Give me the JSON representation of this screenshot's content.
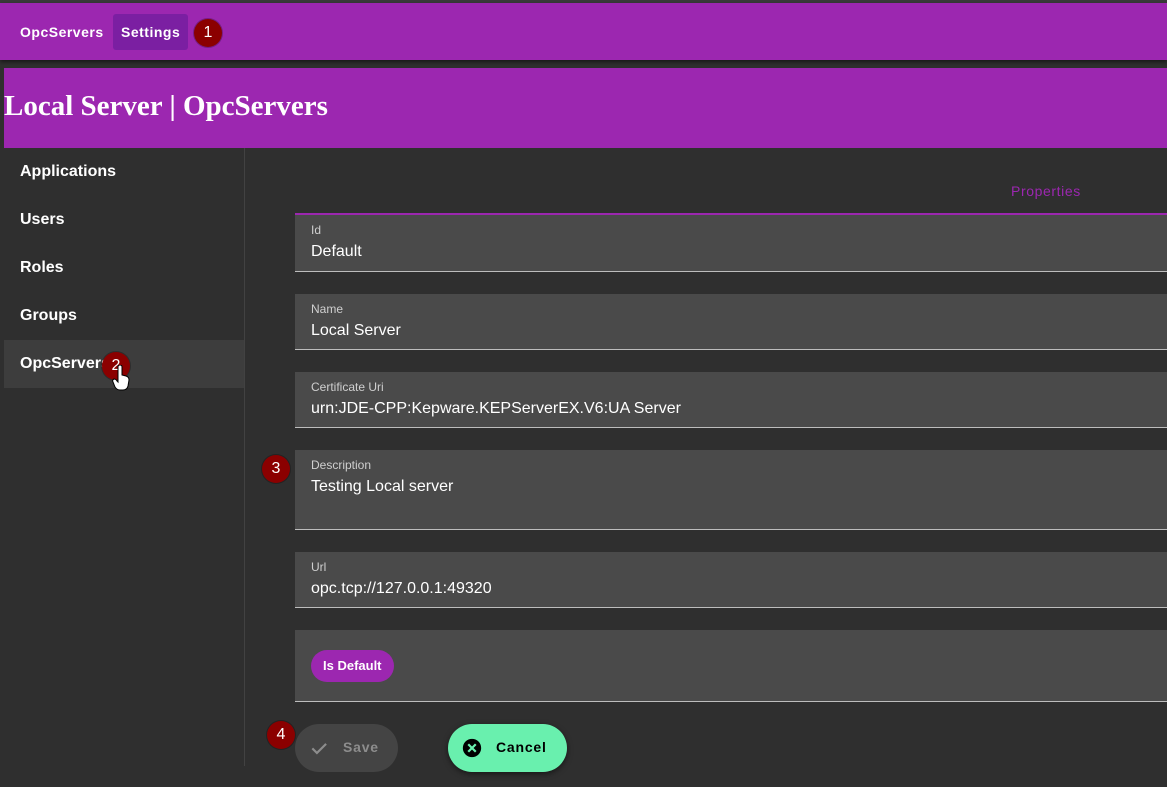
{
  "topbar": {
    "items": [
      {
        "label": "OpcServers"
      },
      {
        "label": "Settings",
        "active": true
      }
    ]
  },
  "markers": [
    "1",
    "2",
    "3",
    "4"
  ],
  "header": {
    "title": "Local Server | OpcServers"
  },
  "sidebar": {
    "items": [
      {
        "label": "Applications"
      },
      {
        "label": "Users"
      },
      {
        "label": "Roles"
      },
      {
        "label": "Groups"
      },
      {
        "label": "OpcServers",
        "active": true
      }
    ]
  },
  "tab": {
    "label": "Properties"
  },
  "form": {
    "id": {
      "label": "Id",
      "value": "Default"
    },
    "name": {
      "label": "Name",
      "value": "Local Server"
    },
    "certificate_uri": {
      "label": "Certificate Uri",
      "value": "urn:JDE-CPP:Kepware.KEPServerEX.V6:UA Server"
    },
    "description": {
      "label": "Description",
      "value": "Testing Local server"
    },
    "url": {
      "label": "Url",
      "value": "opc.tcp://127.0.0.1:49320"
    },
    "is_default": {
      "label": "Is Default"
    }
  },
  "actions": {
    "save": "Save",
    "cancel": "Cancel"
  },
  "colors": {
    "primary": "#9c27b0",
    "accent": "#69f0ae",
    "background": "#2f2f2f",
    "marker": "#8b0000"
  },
  "icons": {
    "save": "check-icon",
    "cancel": "cancel-circle-icon"
  }
}
